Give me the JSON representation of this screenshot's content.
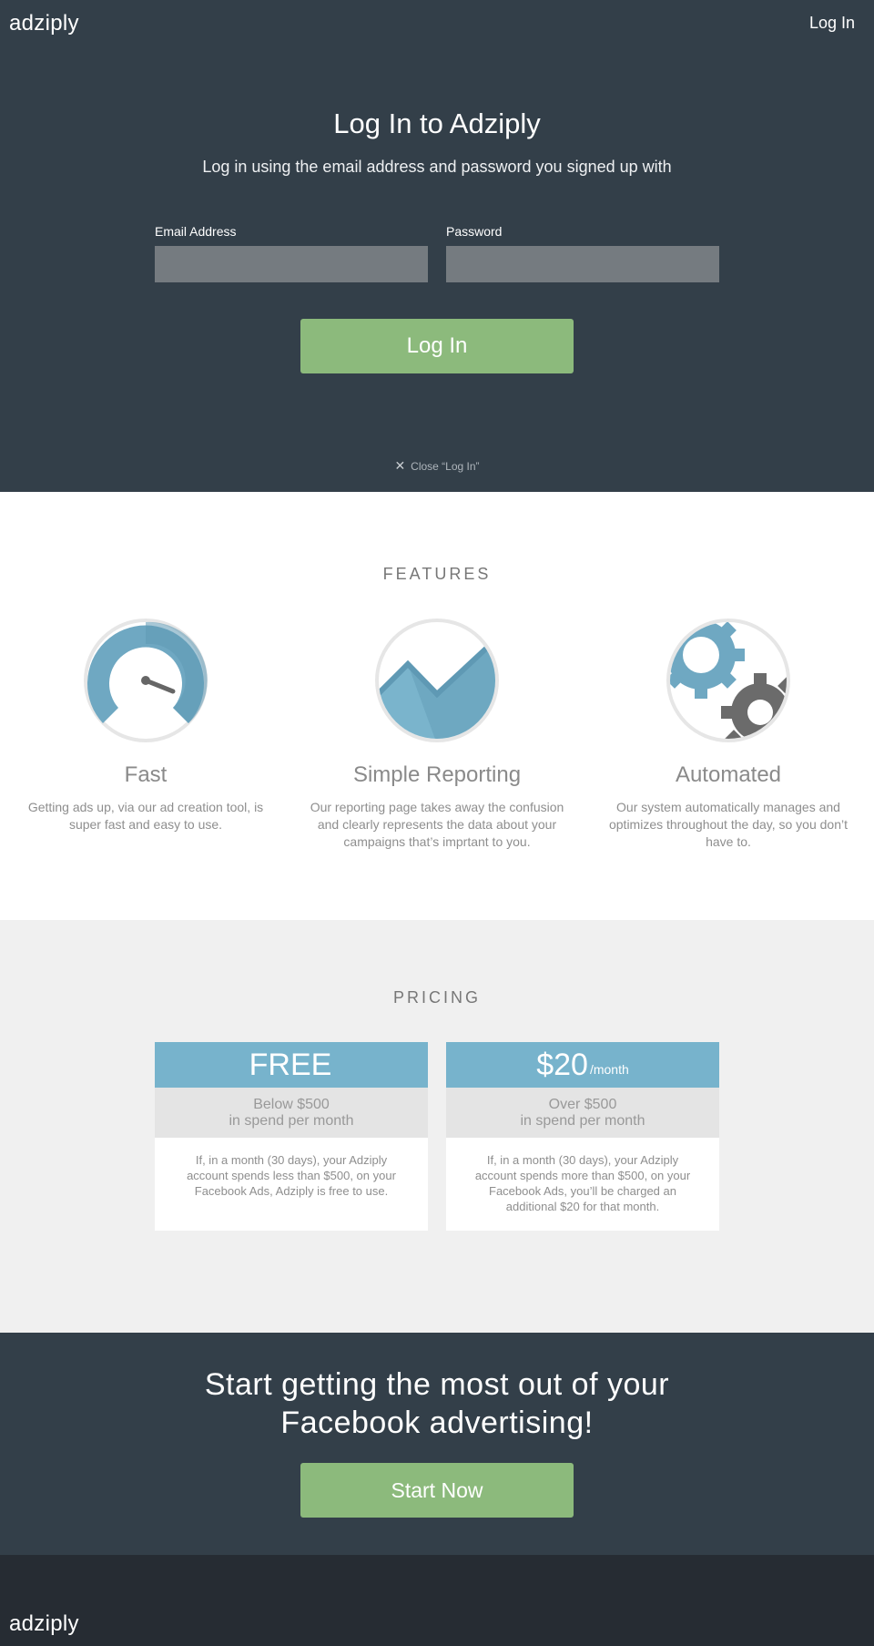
{
  "header": {
    "logo": "adziply",
    "login_link": "Log In"
  },
  "login": {
    "title": "Log In to Adziply",
    "subtitle": "Log in using the email address and password you signed up with",
    "email_label": "Email Address",
    "email_value": "",
    "password_label": "Password",
    "password_value": "",
    "submit_label": "Log In",
    "close_icon": "close-icon",
    "close_label": "Close “Log In”"
  },
  "features": {
    "title": "FEATURES",
    "items": [
      {
        "icon": "speedometer-icon",
        "title": "Fast",
        "description": "Getting ads up, via our ad creation tool, is super fast and easy to use."
      },
      {
        "icon": "line-chart-icon",
        "title": "Simple Reporting",
        "description": "Our reporting page takes away the confusion and clearly represents the data about your campaigns that’s imprtant to you."
      },
      {
        "icon": "gears-icon",
        "title": "Automated",
        "description": "Our system automatically manages and optimizes throughout the day, so you don’t have to."
      }
    ]
  },
  "pricing": {
    "title": "PRICING",
    "plans": [
      {
        "price": "FREE",
        "period": "",
        "band_line1": "Below $500",
        "band_line2": "in spend per month",
        "description": "If, in a month (30 days), your Adziply account spends less than $500, on your Facebook Ads, Adziply is free to use."
      },
      {
        "price": "$20",
        "period": "/month",
        "band_line1": "Over $500",
        "band_line2": "in spend per month",
        "description": "If, in a month (30 days), your Adziply account spends more than $500, on your Facebook Ads, you’ll be charged an additional $20 for that month."
      }
    ]
  },
  "cta": {
    "title_line1": "Start getting the most out of your",
    "title_line2": "Facebook advertising!",
    "button_label": "Start Now"
  },
  "footer": {
    "logo": "adziply"
  },
  "colors": {
    "dark_bg": "#333f49",
    "footer_bg": "#262c33",
    "accent_green": "#8cba7c",
    "accent_blue": "#77b3cc",
    "light_bg": "#f0f0f0"
  }
}
